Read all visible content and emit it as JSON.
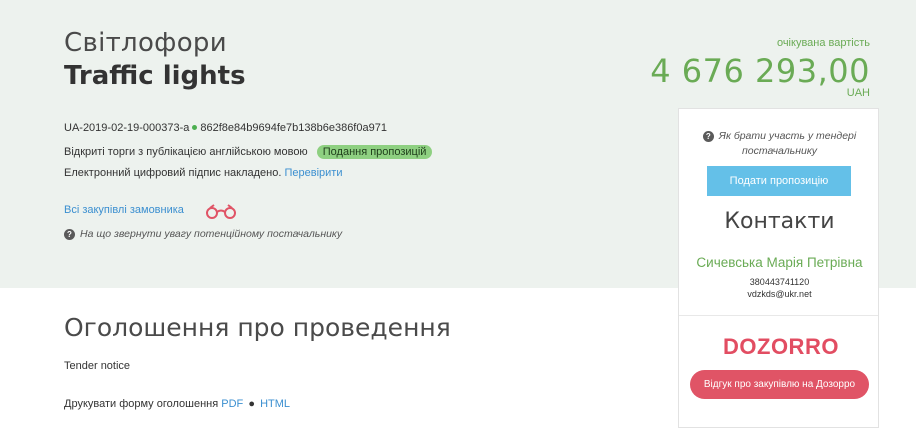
{
  "tender": {
    "title_ua": "Світлофори",
    "title_en": "Traffic lights",
    "id": "UA-2019-02-19-000373-a",
    "hash": "862f8e84b9694fe7b138b6e386f0a971",
    "procedure": "Відкриті торги з публікацією англійською мовою",
    "status_badge": "Подання пропозицій",
    "signature_text": "Електронний цифровий підпис накладено.",
    "verify_link": "Перевірити",
    "all_purchases_link": "Всі закупівлі замовника",
    "attention_text": "На що звернути увагу потенційному постачальнику"
  },
  "price": {
    "label": "очікувана вартість",
    "value": "4 676 293,00",
    "currency": "UAH"
  },
  "card": {
    "howto_text": "Як брати участь у тендері постачальнику",
    "submit_button": "Подати пропозицію",
    "contacts_heading": "Контакти",
    "contact_name": "Сичевська Марія Петрівна",
    "contact_phone": "380443741120",
    "contact_email": "vdzkds@ukr.net",
    "dozorro_logo": "DOZORRO",
    "dozorro_button": "Відгук про закупівлю на Дозорро"
  },
  "notice": {
    "heading": "Оголошення про проведення",
    "subtitle": "Tender notice",
    "print_label": "Друкувати форму оголошення",
    "pdf_link": "PDF",
    "html_link": "HTML"
  },
  "colors": {
    "hero_bg": "#edf2ee",
    "accent_green": "#6aab55",
    "link_blue": "#3b8fd0",
    "submit_blue": "#64c0e8",
    "dozorro_red": "#e24d62"
  },
  "icons": {
    "question": "question-circle-icon",
    "glasses": "glasses-icon",
    "status_dot": "status-dot-icon"
  }
}
